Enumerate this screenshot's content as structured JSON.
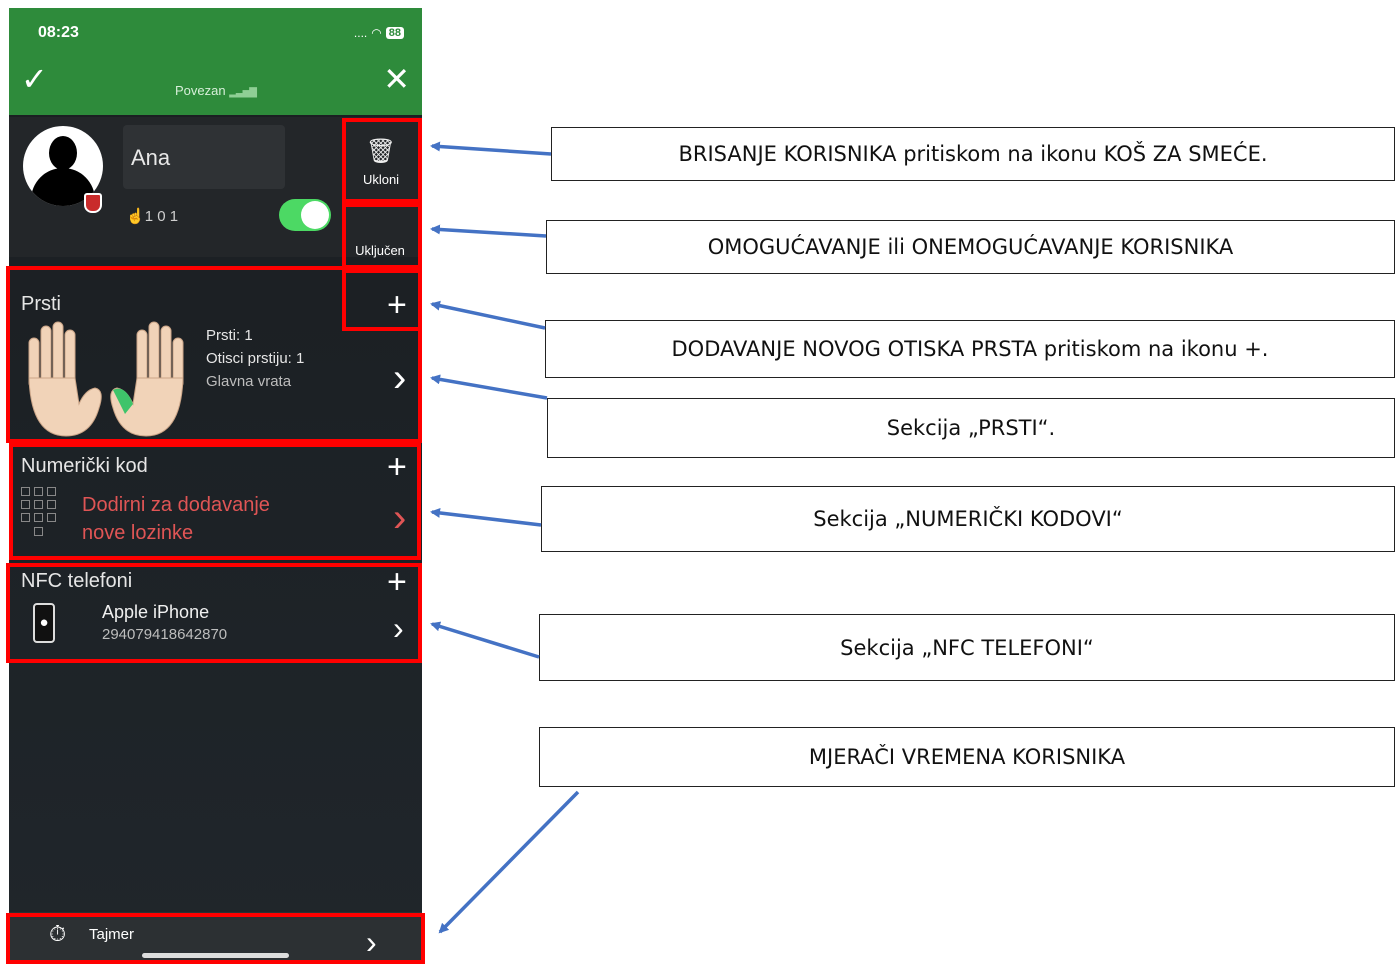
{
  "status": {
    "time": "08:23",
    "signal": "....",
    "battery": "88"
  },
  "nav": {
    "check_icon": "✓",
    "close_icon": "✕",
    "connection": "Povezan"
  },
  "user": {
    "name": "Ana",
    "counts": "1  0  1",
    "delete_label": "Ukloni",
    "enabled_label": "Uključen",
    "enabled": true
  },
  "fingers": {
    "title": "Prsti",
    "count": "Prsti: 1",
    "prints": "Otisci prstiju: 1",
    "door": "Glavna vrata"
  },
  "code": {
    "title": "Numerički kod",
    "line1": "Dodirni za dodavanje",
    "line2": "nove lozinke"
  },
  "nfc": {
    "title": "NFC telefoni",
    "phone_name": "Apple iPhone",
    "phone_id": "294079418642870"
  },
  "timer": {
    "label": "Tajmer"
  },
  "callouts": {
    "delete": "BRISANJE KORISNIKA pritiskom na ikonu KOŠ ZA SMEĆE.",
    "enable": "OMOGUĆAVANJE ili ONEMOGUĆAVANJE KORISNIKA",
    "add_finger": "DODAVANJE NOVOG OTISKA PRSTA pritiskom na ikonu +.",
    "fingers_section": "Sekcija „PRSTI“.",
    "codes_section": "Sekcija „NUMERIČKI KODOVI“",
    "nfc_section": "Sekcija „NFC TELEFONI“",
    "timers": "MJERAČI VREMENA KORISNIKA"
  },
  "colors": {
    "header": "#2e8b3b",
    "highlight": "#ff0000",
    "arrow": "#4472c4"
  }
}
